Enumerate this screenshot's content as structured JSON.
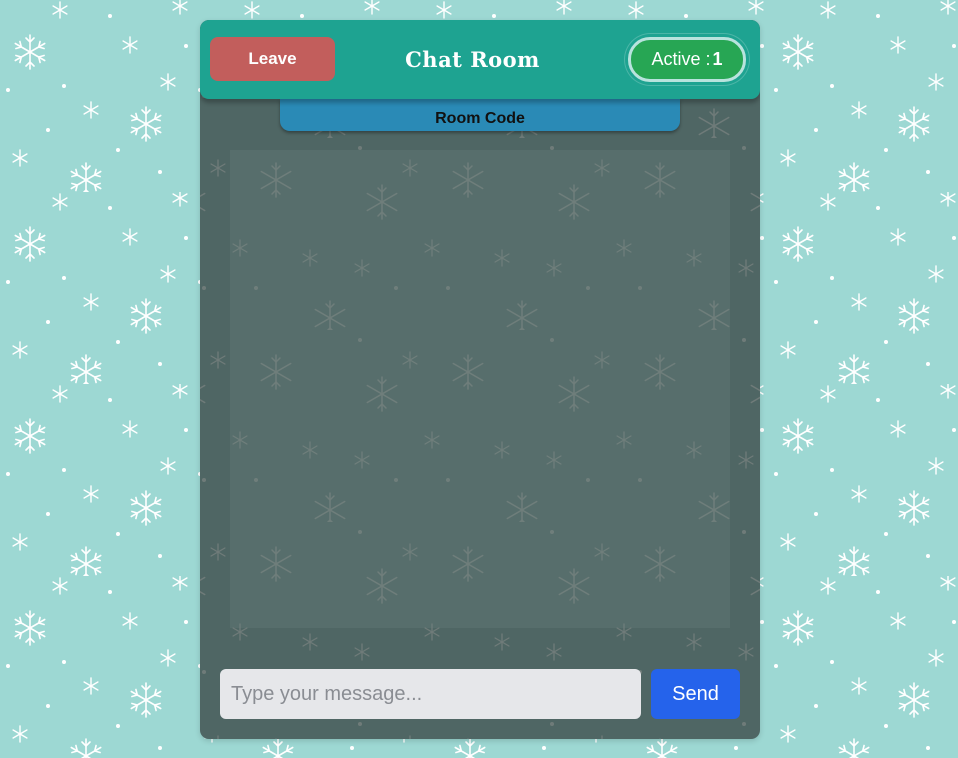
{
  "header": {
    "leave_label": "Leave",
    "title": "Chat Room",
    "active_label": "Active :",
    "active_count": "1"
  },
  "room_code": {
    "label": "Room Code"
  },
  "composer": {
    "placeholder": "Type your message...",
    "value": "",
    "send_label": "Send"
  },
  "messages": [],
  "colors": {
    "page_background": "#9dd8d3",
    "window_background": "#4f6664",
    "header": "#1ea391",
    "leave_button": "#c25e5c",
    "active_badge": "#27a654",
    "room_code_tab": "#2a8ab6",
    "send_button": "#2563eb",
    "input_background": "#e6e7ea"
  },
  "icons": {
    "background_pattern": "snowflake-icon"
  }
}
